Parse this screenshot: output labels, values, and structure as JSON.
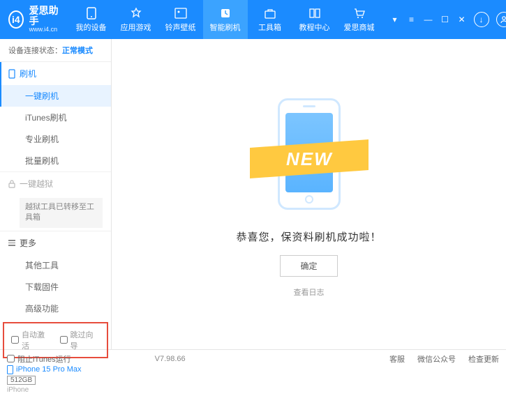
{
  "app": {
    "title": "爱思助手",
    "url": "www.i4.cn"
  },
  "nav": [
    {
      "label": "我的设备"
    },
    {
      "label": "应用游戏"
    },
    {
      "label": "铃声壁纸"
    },
    {
      "label": "智能刷机"
    },
    {
      "label": "工具箱"
    },
    {
      "label": "教程中心"
    },
    {
      "label": "爱思商城"
    }
  ],
  "status": {
    "label": "设备连接状态：",
    "value": "正常模式"
  },
  "sidebar": {
    "flash": {
      "head": "刷机",
      "items": [
        "一键刷机",
        "iTunes刷机",
        "专业刷机",
        "批量刷机"
      ]
    },
    "jailbreak": {
      "head": "一键越狱",
      "note": "越狱工具已转移至工具箱"
    },
    "more": {
      "head": "更多",
      "items": [
        "其他工具",
        "下载固件",
        "高级功能"
      ]
    }
  },
  "checkboxes": {
    "auto_activate": "自动激活",
    "skip_guide": "跳过向导"
  },
  "device": {
    "name": "iPhone 15 Pro Max",
    "storage": "512GB",
    "type": "iPhone"
  },
  "main": {
    "ribbon": "NEW",
    "message": "恭喜您，保资料刷机成功啦！",
    "ok": "确定",
    "log": "查看日志"
  },
  "footer": {
    "block_itunes": "阻止iTunes运行",
    "version": "V7.98.66",
    "links": [
      "客服",
      "微信公众号",
      "检查更新"
    ]
  }
}
